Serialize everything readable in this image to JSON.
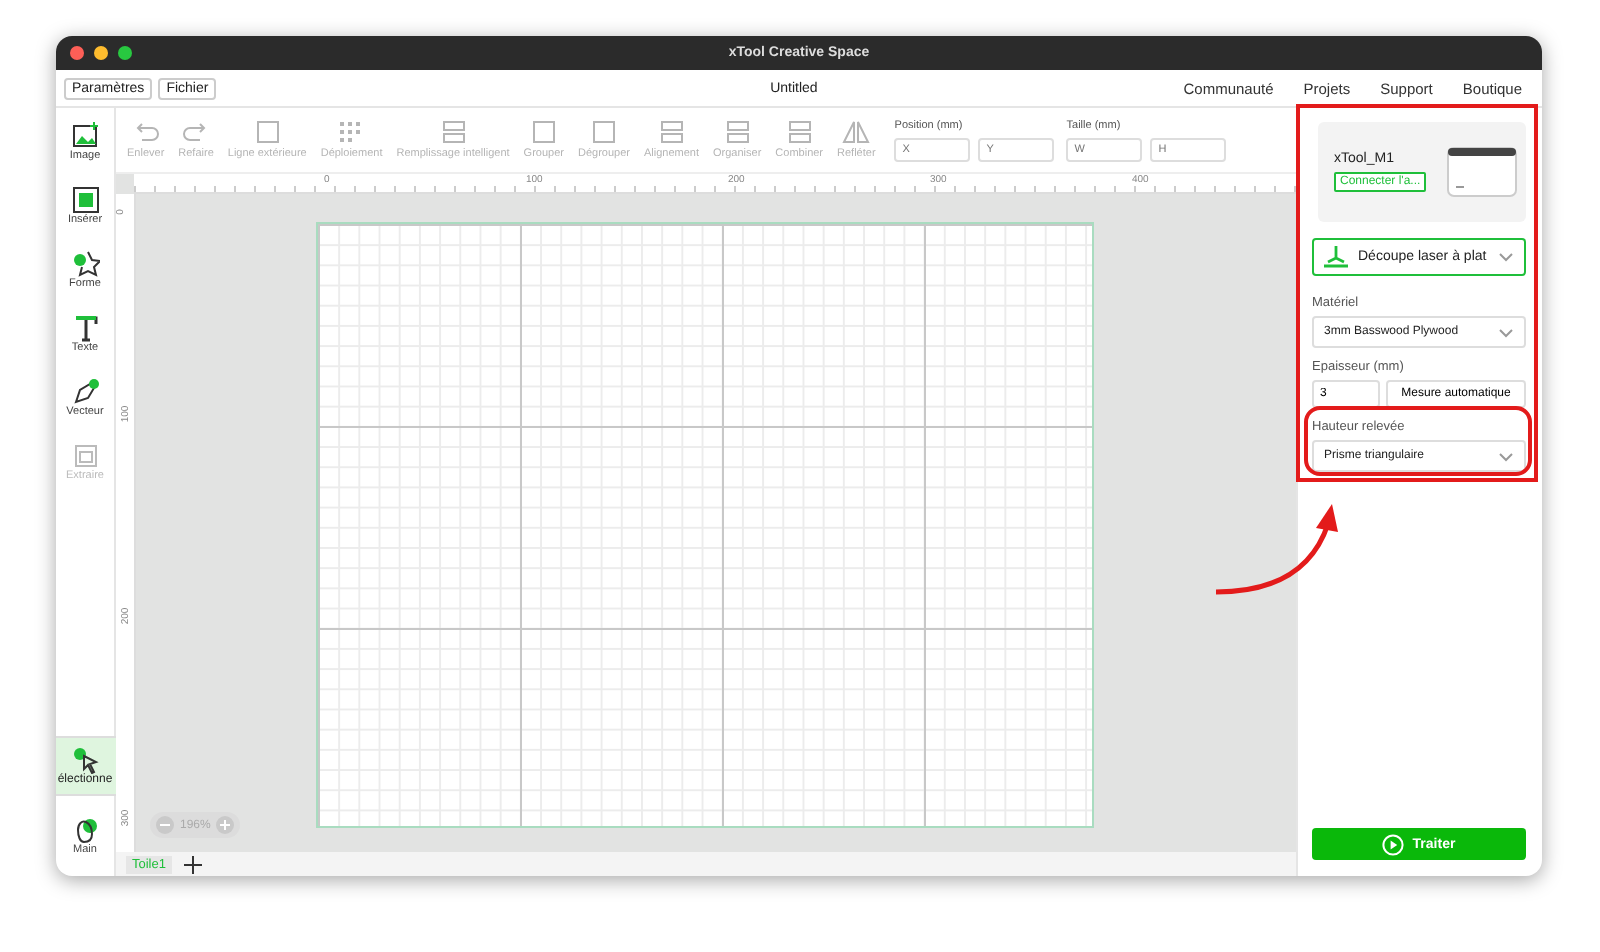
{
  "window": {
    "title": "xTool Creative Space"
  },
  "menu": {
    "buttons": [
      "Paramètres",
      "Fichier"
    ],
    "document_title": "Untitled",
    "links": [
      "Communauté",
      "Projets",
      "Support",
      "Boutique"
    ]
  },
  "toolbar": {
    "items": [
      {
        "label": "Enlever",
        "kind": "undo",
        "disabled": true
      },
      {
        "label": "Refaire",
        "kind": "redo",
        "disabled": true
      },
      {
        "label": "Ligne extérieure",
        "kind": "outline",
        "disabled": true
      },
      {
        "label": "Déploiement",
        "kind": "array",
        "disabled": true
      },
      {
        "label": "Remplissage intelligent",
        "kind": "fill",
        "disabled": true
      },
      {
        "label": "Grouper",
        "kind": "group",
        "disabled": true
      },
      {
        "label": "Dégrouper",
        "kind": "ungroup",
        "disabled": true
      },
      {
        "label": "Alignement",
        "kind": "align",
        "disabled": true
      },
      {
        "label": "Organiser",
        "kind": "arrange",
        "disabled": true
      },
      {
        "label": "Combiner",
        "kind": "combine",
        "disabled": true
      },
      {
        "label": "Refléter",
        "kind": "reflect",
        "disabled": true
      }
    ],
    "position": {
      "label": "Position (mm)",
      "fields": [
        {
          "placeholder": "X"
        },
        {
          "placeholder": "Y"
        }
      ]
    },
    "size": {
      "label": "Taille (mm)",
      "fields": [
        {
          "placeholder": "W"
        },
        {
          "placeholder": "H"
        }
      ]
    }
  },
  "sidebar": {
    "items": [
      {
        "label": "Image",
        "kind": "image",
        "disabled": false,
        "selected": false
      },
      {
        "label": "Insérer",
        "kind": "insert",
        "disabled": false,
        "selected": false
      },
      {
        "label": "Forme",
        "kind": "shape",
        "disabled": false,
        "selected": false
      },
      {
        "label": "Texte",
        "kind": "text",
        "disabled": false,
        "selected": false
      },
      {
        "label": "Vecteur",
        "kind": "pen",
        "disabled": false,
        "selected": false
      },
      {
        "label": "Extraire",
        "kind": "extract",
        "disabled": true,
        "selected": false
      }
    ],
    "bottom_items": [
      {
        "label": "électionne",
        "kind": "select",
        "disabled": false,
        "selected": true
      },
      {
        "label": "Main",
        "kind": "hand",
        "disabled": false,
        "selected": false
      }
    ]
  },
  "ruler": {
    "x_labels": [
      "0",
      "100",
      "200",
      "300",
      "400"
    ],
    "y_labels": [
      "0",
      "100",
      "200",
      "300"
    ]
  },
  "zoom": {
    "value": "196%"
  },
  "canvas_tabs": [
    {
      "label": "Toile1",
      "selected": true
    }
  ],
  "panel": {
    "device": {
      "name": "xTool_M1",
      "connect": "Connecter l'a..."
    },
    "mode": "Découpe laser à plat",
    "material": {
      "label": "Matériel",
      "value": "3mm Basswood Plywood"
    },
    "thickness": {
      "label": "Epaisseur (mm)",
      "value": "3",
      "button": "Mesure automatique"
    },
    "raised_height": {
      "label": "Hauteur relevée",
      "value": "Prisme triangulaire"
    },
    "process": "Traiter"
  }
}
